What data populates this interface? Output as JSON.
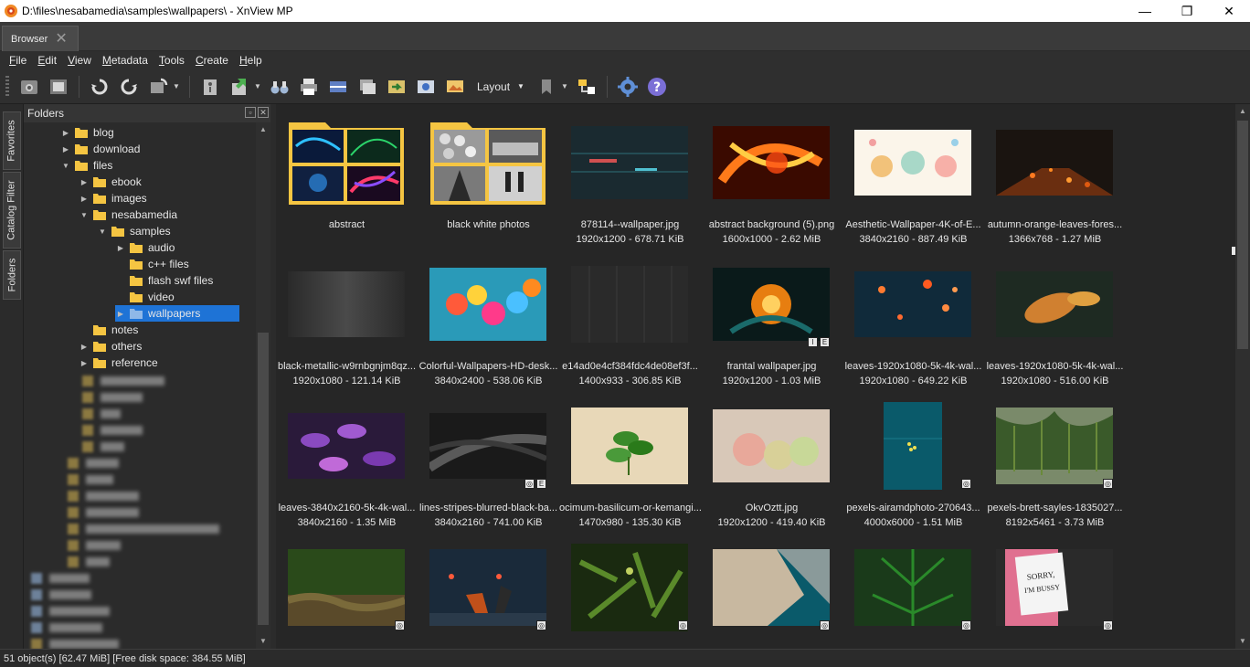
{
  "window": {
    "title": "D:\\files\\nesabamedia\\samples\\wallpapers\\ - XnView MP",
    "minimize": "—",
    "maximize": "❐",
    "close": "✕"
  },
  "tabs": [
    {
      "label": "Browser",
      "close": "✕"
    }
  ],
  "menu": [
    {
      "label": "File",
      "underline": "F",
      "rest": "ile"
    },
    {
      "label": "Edit",
      "underline": "E",
      "rest": "dit"
    },
    {
      "label": "View",
      "underline": "V",
      "rest": "iew"
    },
    {
      "label": "Metadata",
      "underline": "M",
      "rest": "etadata"
    },
    {
      "label": "Tools",
      "underline": "T",
      "rest": "ools"
    },
    {
      "label": "Create",
      "underline": "C",
      "rest": "reate"
    },
    {
      "label": "Help",
      "underline": "H",
      "rest": "elp"
    }
  ],
  "toolbar": {
    "layout_label": "Layout"
  },
  "sidetabs": [
    "Favorites",
    "Catalog Filter",
    "Folders"
  ],
  "folders_panel": {
    "title": "Folders",
    "nodes": [
      {
        "label": "blog",
        "arrow": "▶"
      },
      {
        "label": "download",
        "arrow": "▶"
      },
      {
        "label": "files",
        "arrow": "▼"
      },
      {
        "label": "ebook",
        "arrow": "▶"
      },
      {
        "label": "images",
        "arrow": "▶"
      },
      {
        "label": "nesabamedia",
        "arrow": "▼"
      },
      {
        "label": "samples",
        "arrow": "▼"
      },
      {
        "label": "audio",
        "arrow": "▶"
      },
      {
        "label": "c++ files",
        "arrow": ""
      },
      {
        "label": "flash swf files",
        "arrow": ""
      },
      {
        "label": "video",
        "arrow": ""
      },
      {
        "label": "wallpapers",
        "arrow": "▶"
      },
      {
        "label": "notes",
        "arrow": ""
      },
      {
        "label": "others",
        "arrow": "▶"
      },
      {
        "label": "reference",
        "arrow": "▶"
      }
    ]
  },
  "thumbnails": [
    {
      "name": "abstract",
      "meta": ""
    },
    {
      "name": "black white photos",
      "meta": ""
    },
    {
      "name": "878114--wallpaper.jpg",
      "meta": "1920x1200 - 678.71 KiB"
    },
    {
      "name": "abstract background (5).png",
      "meta": "1600x1000 - 2.62 MiB"
    },
    {
      "name": "Aesthetic-Wallpaper-4K-of-E...",
      "meta": "3840x2160 - 887.49 KiB"
    },
    {
      "name": "autumn-orange-leaves-fores...",
      "meta": "1366x768 - 1.27 MiB"
    },
    {
      "name": "black-metallic-w9rnbgnjm8qz...",
      "meta": "1920x1080 - 121.14 KiB"
    },
    {
      "name": "Colorful-Wallpapers-HD-desk...",
      "meta": "3840x2400 - 538.06 KiB"
    },
    {
      "name": "e14ad0e4cf384fdc4de08ef3f...",
      "meta": "1400x933 - 306.85 KiB"
    },
    {
      "name": "frantal wallpaper.jpg",
      "meta": "1920x1200 - 1.03 MiB"
    },
    {
      "name": "leaves-1920x1080-5k-4k-wal...",
      "meta": "1920x1080 - 649.22 KiB"
    },
    {
      "name": "leaves-1920x1080-5k-4k-wal...",
      "meta": "1920x1080 - 516.00 KiB"
    },
    {
      "name": "leaves-3840x2160-5k-4k-wal...",
      "meta": "3840x2160 - 1.35 MiB"
    },
    {
      "name": "lines-stripes-blurred-black-ba...",
      "meta": "3840x2160 - 741.00 KiB"
    },
    {
      "name": "ocimum-basilicum-or-kemangi...",
      "meta": "1470x980 - 135.30 KiB"
    },
    {
      "name": "OkvOztt.jpg",
      "meta": "1920x1200 - 419.40 KiB"
    },
    {
      "name": "pexels-airamdphoto-270643...",
      "meta": "4000x6000 - 1.51 MiB"
    },
    {
      "name": "pexels-brett-sayles-1835027...",
      "meta": "8192x5461 - 3.73 MiB"
    },
    {
      "name": "",
      "meta": ""
    },
    {
      "name": "",
      "meta": ""
    },
    {
      "name": "",
      "meta": ""
    },
    {
      "name": "",
      "meta": ""
    },
    {
      "name": "",
      "meta": ""
    },
    {
      "name": "",
      "meta": ""
    }
  ],
  "badges": {
    "info": "I",
    "exif": "E",
    "photo": "◎"
  },
  "folder_card": {
    "sorry_text_1": "SORRY,",
    "sorry_text_2": "I'M BUSSY"
  },
  "statusbar": {
    "text": "51 object(s) [62.47 MiB] [Free disk space: 384.55 MiB]"
  },
  "colors": {
    "selection": "#1e73d6",
    "folder": "#f5c542",
    "background": "#262626"
  }
}
